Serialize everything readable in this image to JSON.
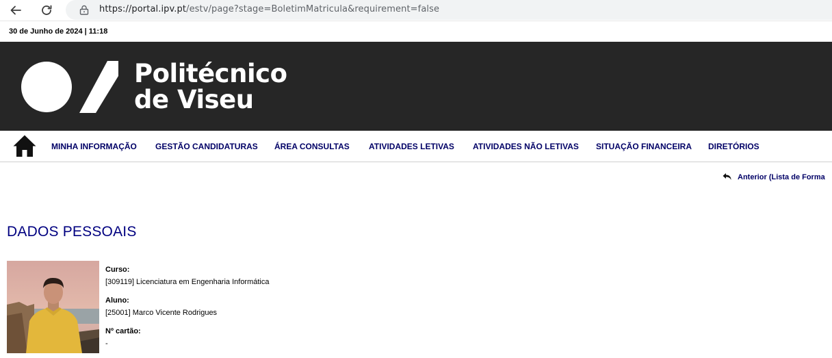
{
  "browser": {
    "url_host": "https://portal.ipv.pt",
    "url_path": "/estv/page?stage=BoletimMatricula&requirement=false"
  },
  "header": {
    "date_line": "30 de Junho de 2024 | 11:18",
    "logo_line1": "Politécnico",
    "logo_line2": "de Viseu"
  },
  "menu": {
    "items": [
      "MINHA INFORMAÇÃO",
      "GESTÃO CANDIDATURAS",
      "ÁREA CONSULTAS",
      "ATIVIDADES LETIVAS",
      "ATIVIDADES NÃO LETIVAS",
      "SITUAÇÃO FINANCEIRA",
      "DIRETÓRIOS"
    ]
  },
  "back_link": {
    "label": "Anterior (Lista de Forma"
  },
  "section": {
    "title": "DADOS PESSOAIS"
  },
  "student": {
    "course_label": "Curso:",
    "course_value": "[309119] Licenciatura em Engenharia Informática",
    "student_label": "Aluno:",
    "student_value": "[25001] Marco Vicente Rodrigues",
    "card_label": "Nº cartão:",
    "card_value": "-"
  },
  "colors": {
    "banner_bg": "#262626",
    "menu_text": "#000066",
    "title_text": "#000080"
  }
}
